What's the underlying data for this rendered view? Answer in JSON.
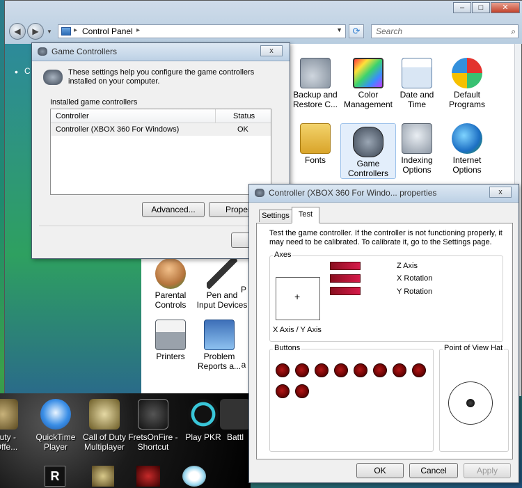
{
  "explorer": {
    "breadcrumb": "Control Panel",
    "search_placeholder": "Search",
    "left_bullets": [
      "•",
      "•"
    ],
    "items": [
      {
        "label1": "Backup and",
        "label2": "Restore C..."
      },
      {
        "label1": "Color",
        "label2": "Management"
      },
      {
        "label1": "Date and",
        "label2": "Time"
      },
      {
        "label1": "Default",
        "label2": "Programs"
      },
      {
        "label1": "Fonts",
        "label2": ""
      },
      {
        "label1": "Game",
        "label2": "Controllers"
      },
      {
        "label1": "Indexing",
        "label2": "Options"
      },
      {
        "label1": "Internet",
        "label2": "Options"
      },
      {
        "label1": "Parental",
        "label2": "Controls"
      },
      {
        "label1": "Pen and",
        "label2": "Input Devices"
      },
      {
        "label1": "Printers",
        "label2": ""
      },
      {
        "label1": "Problem",
        "label2": "Reports a..."
      },
      {
        "label1": "P",
        "label2": ""
      },
      {
        "label1": "a",
        "label2": ""
      }
    ]
  },
  "desktop": {
    "icons": [
      {
        "label1": "l Duty -",
        "label2": "d Offe..."
      },
      {
        "label1": "QuickTime",
        "label2": "Player"
      },
      {
        "label1": "Call of Duty",
        "label2": "Multiplayer"
      },
      {
        "label1": "FretsOnFire -",
        "label2": "Shortcut"
      },
      {
        "label1": "Play PKR",
        "label2": ""
      },
      {
        "label1": "Battl",
        "label2": ""
      }
    ]
  },
  "game_controllers": {
    "title": "Game Controllers",
    "close_label": "x",
    "description": "These settings help you configure the game controllers installed on your computer.",
    "group_label": "Installed game controllers",
    "col_controller": "Controller",
    "col_status": "Status",
    "rows": [
      {
        "controller": "Controller (XBOX 360 For Windows)",
        "status": "OK"
      }
    ],
    "advanced_label": "Advanced...",
    "properties_label": "Properti"
  },
  "properties": {
    "title": "Controller (XBOX 360 For Windo... properties",
    "close_label": "x",
    "tabs": [
      "Settings",
      "Test"
    ],
    "active_tab": "Test",
    "description": "Test the game controller.  If the controller is not functioning properly, it may need to be calibrated.  To calibrate it, go to the Settings page.",
    "axes_label": "Axes",
    "xy_label": "X Axis / Y Axis",
    "axis_bars": [
      {
        "label": "Z Axis",
        "value": 1.0
      },
      {
        "label": "X Rotation",
        "value": 1.0
      },
      {
        "label": "Y Rotation",
        "value": 1.0
      }
    ],
    "buttons_label": "Buttons",
    "button_count": 10,
    "pov_label": "Point of View Hat",
    "ok_label": "OK",
    "cancel_label": "Cancel",
    "apply_label": "Apply"
  },
  "colors": {
    "frame": "#c41418",
    "bar_start": "#8a0f1f",
    "bar_end": "#d61a4a",
    "button_dot": "#8b0b0b"
  }
}
